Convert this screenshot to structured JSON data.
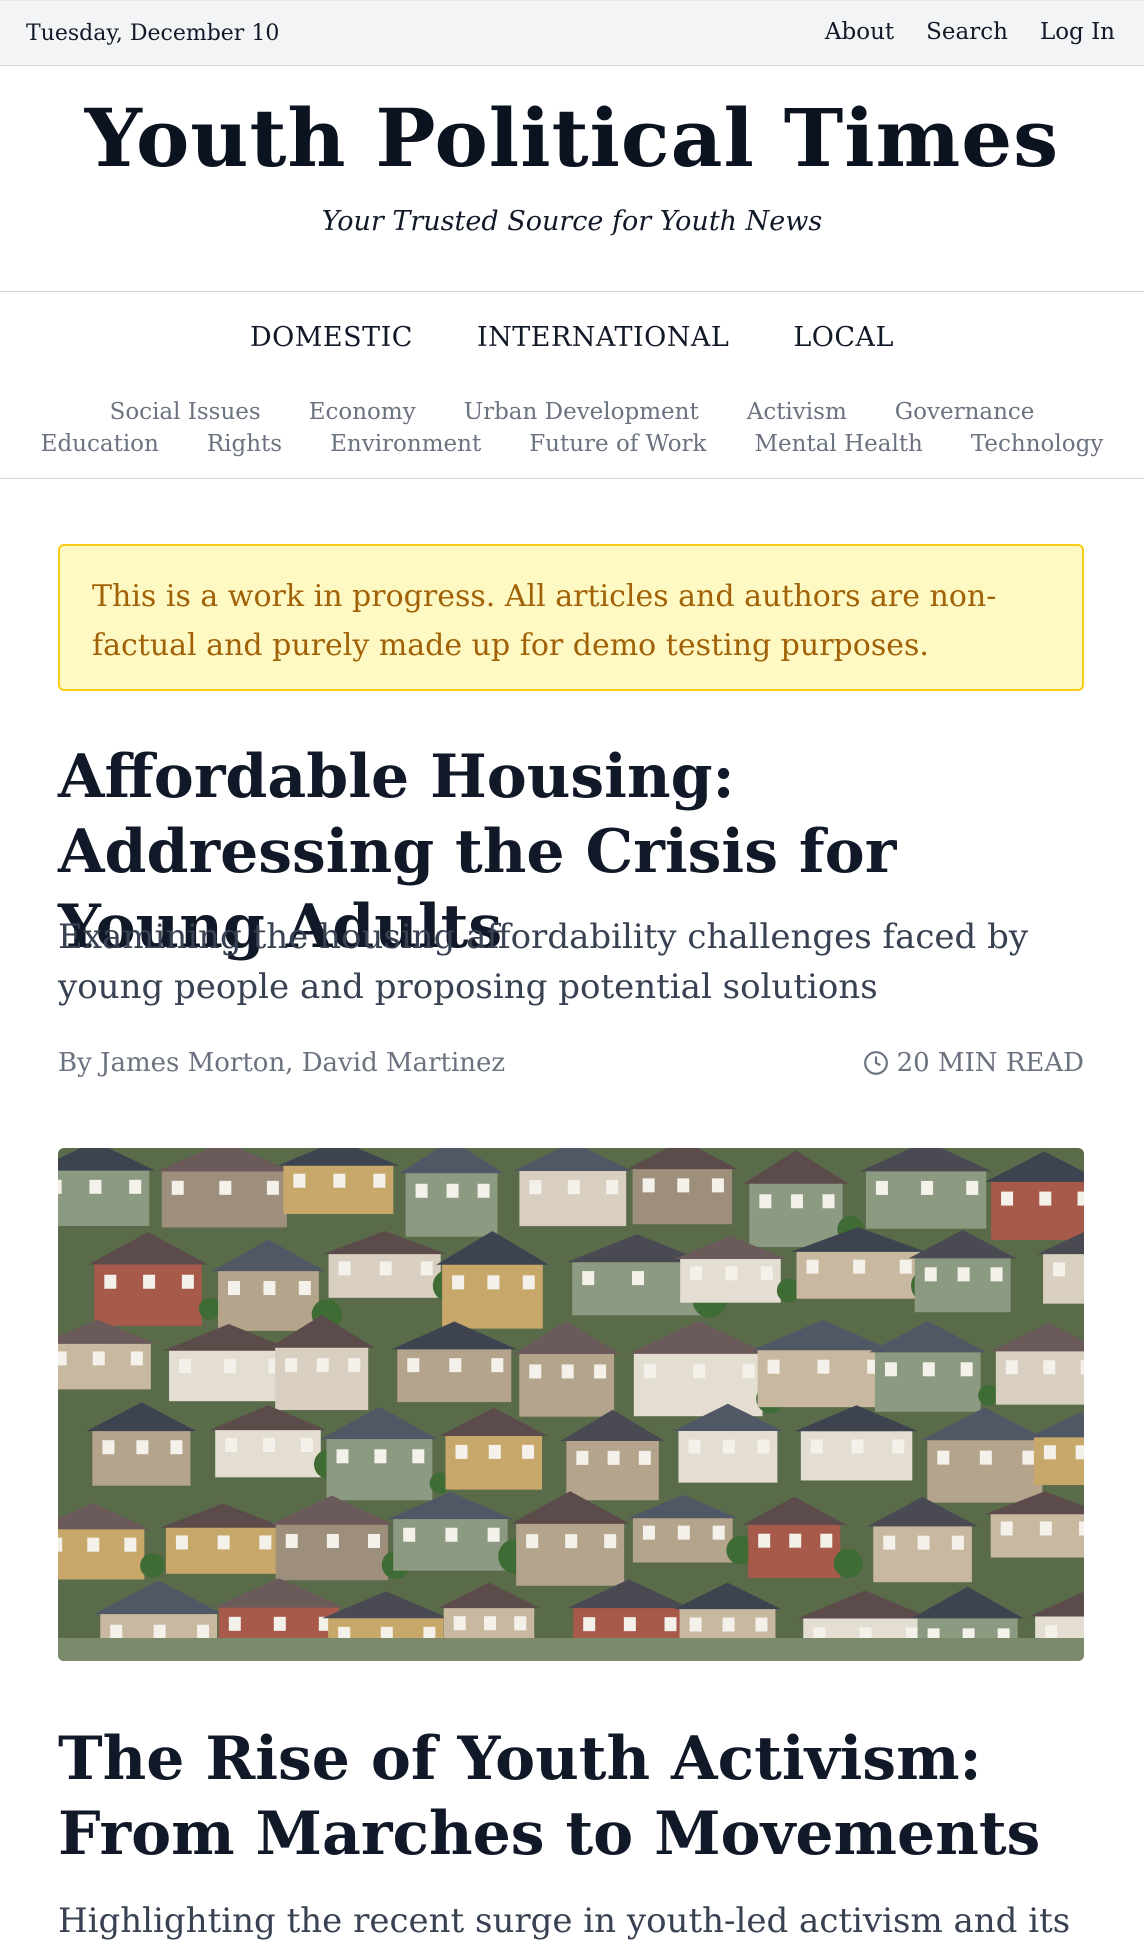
{
  "topbar": {
    "date": "Tuesday, December 10",
    "links": [
      "About",
      "Search",
      "Log In"
    ]
  },
  "masthead": {
    "logo": "Youth Political Times",
    "tagline": "Your Trusted Source for Youth News"
  },
  "nav": {
    "primary": [
      "DOMESTIC",
      "INTERNATIONAL",
      "LOCAL"
    ],
    "secondary": [
      "Social Issues",
      "Economy",
      "Urban Development",
      "Activism",
      "Governance",
      "Education",
      "Rights",
      "Environment",
      "Future of Work",
      "Mental Health",
      "Technology"
    ]
  },
  "notice": {
    "text": "This is a work in progress. All articles and authors are non-factual and purely made up for demo testing purposes."
  },
  "articles": [
    {
      "title": "Affordable Housing: Addressing the Crisis for Young Adults",
      "subtitle": "Examining the housing affordability challenges faced by young people and proposing potential solutions",
      "byline": "By James Morton, David Martinez",
      "read_time": "20 MIN READ",
      "image_icon": "clock-icon"
    },
    {
      "title": "The Rise of Youth Activism: From Marches to Movements",
      "subtitle": "Highlighting the recent surge in youth-led activism and its"
    }
  ],
  "colors": {
    "notice_bg": "#fef9c3",
    "notice_border": "#facc15",
    "notice_text": "#a16207",
    "topbar_bg": "#f3f4f6"
  }
}
